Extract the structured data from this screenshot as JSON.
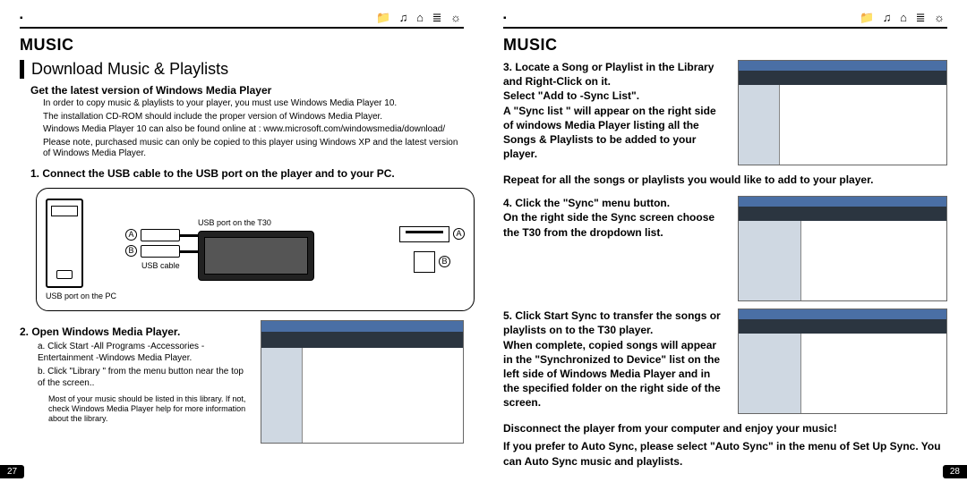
{
  "top_icons": "📁 ♫ ⌂ ≣ ☼",
  "left": {
    "title": "MUSIC",
    "section_heading": "Download Music & Playlists",
    "subhead": "Get the latest version of Windows Media Player",
    "intro1": "In order to copy music & playlists to your player, you must use Windows Media Player 10.",
    "intro2": "The installation CD-ROM should include the proper version of Windows Media Player.",
    "intro3": "Windows Media Player 10 can also be found online at : www.microsoft.com/windowsmedia/download/",
    "intro4": "Please note, purchased music can only be copied to this player using Windows XP and the latest version of Windows Media Player.",
    "step1": "1. Connect the USB cable to the USB port on the player and to your PC.",
    "diag": {
      "a": "A",
      "b": "B",
      "usb_t30": "USB port on the T30",
      "usb_pc": "USB port on the PC",
      "usb_cable": "USB cable"
    },
    "step2": "2. Open Windows Media Player.",
    "step2a": "a. Click Start -All Programs -Accessories - Entertainment -Windows Media Player.",
    "step2b": "b. Click \"Library \" from the menu button near the top of the screen..",
    "step2_fine": "Most of your music should be listed in this library. If not, check Windows Media Player help for more information about the library.",
    "page_num": "27"
  },
  "right": {
    "title": "MUSIC",
    "step3a": "3. Locate a Song or Playlist in the Library and Right-Click on it.",
    "step3b": "Select \"Add to -Sync List\".",
    "step3c": "A \"Sync list \" will appear on the right side of windows Media Player listing all the Songs & Playlists to be added to your player.",
    "step3d": "Repeat for all the songs or playlists you would like to add to your player.",
    "step4a": "4. Click the \"Sync\" menu button.",
    "step4b": "On the right side the Sync screen choose the T30 from the dropdown list.",
    "step5a": "5. Click Start Sync to transfer the songs or playlists on to the T30 player.",
    "step5b": "When complete, copied songs will appear in the \"Synchronized to Device\" list on the left side of Windows Media Player and in the specified folder on the right side of the screen.",
    "footer1": "Disconnect the player from your computer and enjoy your music!",
    "footer2": "If you prefer to Auto Sync, please select \"Auto Sync\" in the menu of Set Up Sync. You can Auto Sync music and playlists.",
    "page_num": "28"
  }
}
